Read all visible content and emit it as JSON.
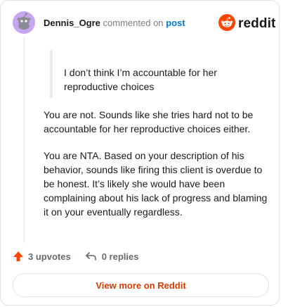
{
  "header": {
    "username": "Dennis_Ogre",
    "action_text": "commented on",
    "post_link": "post",
    "brand": "reddit"
  },
  "comment": {
    "quote": "I don’t think I’m accountable for her reproductive choices",
    "paragraphs": [
      "You are not. Sounds like she tries hard not to be accountable for her reproductive choices either.",
      "You are NTA. Based on your description of his behavior, sounds like firing this client is overdue to be honest. It’s likely she would have been complaining about his lack of progress and blaming it on your eventually regardless."
    ]
  },
  "actions": {
    "upvotes": "3 upvotes",
    "replies": "0 replies"
  },
  "footer": {
    "view_more": "View more on Reddit"
  },
  "colors": {
    "accent": "#ff4500",
    "link_blue": "#0079d3",
    "view_more": "#d93a00",
    "avatar_bg": "#c6a6f3"
  },
  "icons": [
    "snoo-avatar-icon",
    "reddit-logo-icon",
    "upvote-arrow-icon",
    "reply-arrow-icon"
  ]
}
